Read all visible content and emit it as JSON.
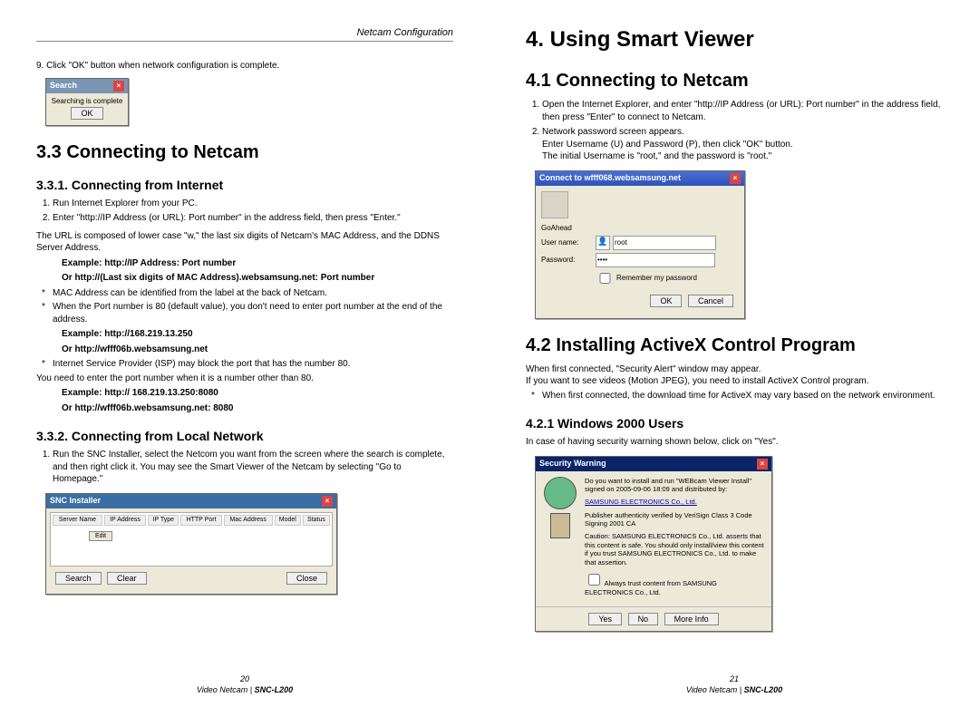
{
  "left": {
    "header": "Netcam Configuration",
    "step9": "9. Click \"OK\" button when network configuration is complete.",
    "searchDlg": {
      "title": "Search",
      "body": "Searching is complete",
      "ok": "OK"
    },
    "h2": "3.3 Connecting to Netcam",
    "h3a": "3.3.1. Connecting from Internet",
    "li1": "Run Internet Explorer from your PC.",
    "li2": "Enter \"http://IP Address (or URL): Port number\" in the address field, then press \"Enter.\"",
    "urlnote": "The URL is composed of lower case \"w,\" the last six digits of Netcam's MAC Address, and the DDNS Server Address.",
    "ex1a": "Example: http://IP Address: Port number",
    "ex1b": "Or http://(Last six digits of MAC Address).websamsung.net: Port number",
    "b1": "MAC Address can be identified from the label at the back of Netcam.",
    "b2": "When the Port number is 80 (default value), you don't need to enter port number at the end of the address.",
    "ex2a": "Example: http://168.219.13.250",
    "ex2b": "Or http://wfff06b.websamsung.net",
    "b3": "Internet Service Provider (ISP) may block the port that has the number 80.",
    "b3b": "You need to enter the port number when it is a number other than 80.",
    "ex3a": "Example: http:// 168.219.13.250:8080",
    "ex3b": "Or http://wfff06b.websamsung.net: 8080",
    "h3b": "3.3.2. Connecting from Local Network",
    "local1": "Run the SNC Installer, select the Netcom you want from the screen where the search is complete, and then right click it. You may see the Smart Viewer of the Netcam by selecting \"Go to Homepage.\"",
    "sncDlg": {
      "title": "SNC Installer",
      "cols": [
        "Server Name",
        "IP Address",
        "IP Type",
        "HTTP Port",
        "Mac Address",
        "Model",
        "Status"
      ],
      "menu": "Edit",
      "btn1": "Search",
      "btn2": "Clear",
      "btn3": "Close"
    },
    "pagenum": "20",
    "model": "Video Netcam | SNC-L200"
  },
  "right": {
    "chapter": "4. Using Smart Viewer",
    "h2a": "4.1 Connecting to Netcam",
    "li1": "Open the Internet Explorer, and enter \"http://IP Address (or URL): Port number\" in the address field, then press \"Enter\" to connect to Netcam.",
    "li2": "Network password screen appears.",
    "li2b": "Enter Username (U) and Password (P), then click \"OK\" button.",
    "li2c": "The initial Username is \"root,\" and the password is \"root.\"",
    "loginDlg": {
      "title": "Connect to wfff068.websamsung.net",
      "realm": "GoAhead",
      "userLbl": "User name:",
      "userVal": "root",
      "passLbl": "Password:",
      "passVal": "••••",
      "remember": "Remember my password",
      "ok": "OK",
      "cancel": "Cancel"
    },
    "h2b": "4.2 Installing ActiveX Control Program",
    "p1": "When first connected, \"Security Alert\" window may appear.",
    "p2": "If you want to see videos (Motion JPEG), you need to install ActiveX Control program.",
    "b1": "When first connected, the download time for ActiveX may vary based on the network environment.",
    "h3": "4.2.1 Windows 2000 Users",
    "p3": "In case of having security warning shown below, click on \"Yes\".",
    "secDlg": {
      "title": "Security Warning",
      "l1": "Do you want to install and run \"WEBcam Viewer Install\" signed on 2005-09-06 18:09 and distributed by:",
      "l2": "SAMSUNG ELECTRONICS Co., Ltd.",
      "l3": "Publisher authenticity verified by VeriSign Class 3 Code Signing 2001 CA",
      "l4": "Caution: SAMSUNG ELECTRONICS Co., Ltd. asserts that this content is safe. You should only install/view this content if you trust SAMSUNG ELECTRONICS Co., Ltd. to make that assertion.",
      "chk": "Always trust content from SAMSUNG ELECTRONICS Co., Ltd.",
      "yes": "Yes",
      "no": "No",
      "more": "More Info"
    },
    "pagenum": "21",
    "model": "Video Netcam | SNC-L200"
  }
}
